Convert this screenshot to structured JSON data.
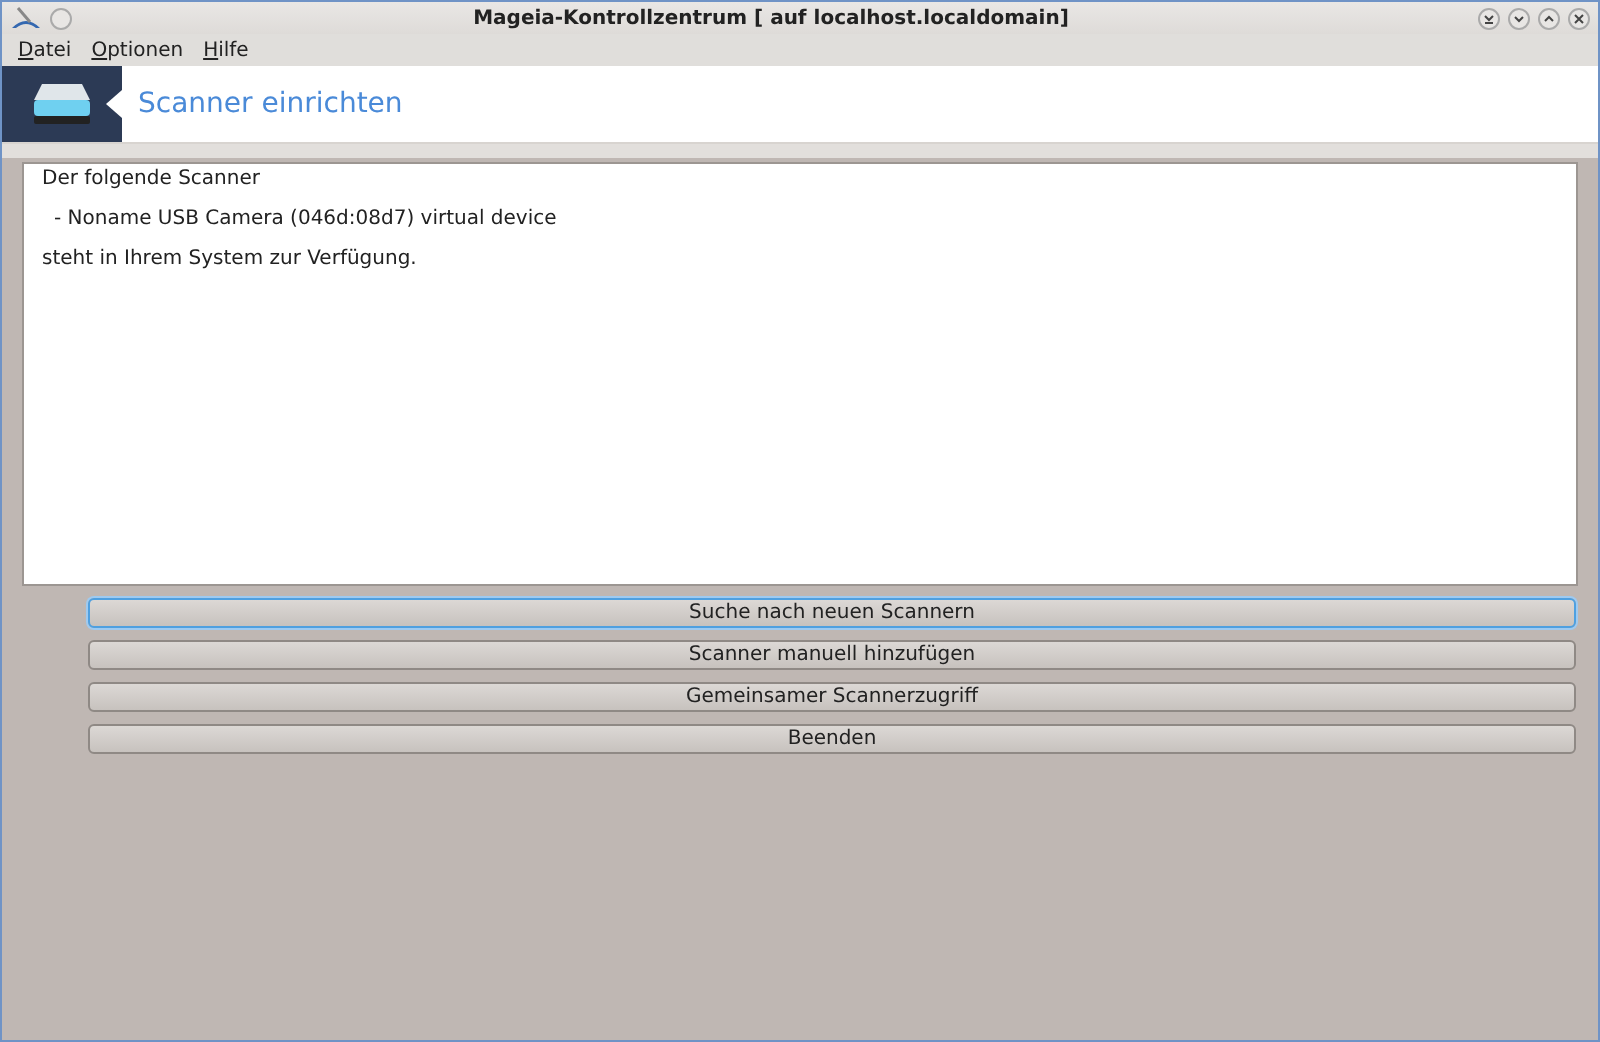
{
  "window": {
    "title": "Mageia-Kontrollzentrum  [ auf localhost.localdomain]"
  },
  "menu": [
    {
      "label": "Datei"
    },
    {
      "label": "Optionen"
    },
    {
      "label": "Hilfe"
    }
  ],
  "header": {
    "title": "Scanner einrichten"
  },
  "message": {
    "lines": [
      {
        "kind": "text",
        "text": "Der folgende Scanner"
      },
      {
        "kind": "item",
        "text": "-  Noname USB Camera (046d:08d7) virtual device"
      },
      {
        "kind": "text",
        "text": "steht in Ihrem System zur Verfügung."
      }
    ]
  },
  "buttons": [
    {
      "label": "Suche nach neuen Scannern",
      "focused": true
    },
    {
      "label": "Scanner manuell hinzufügen",
      "focused": false
    },
    {
      "label": "Gemeinsamer Scannerzugriff",
      "focused": false
    },
    {
      "label": "Beenden",
      "focused": false
    }
  ]
}
